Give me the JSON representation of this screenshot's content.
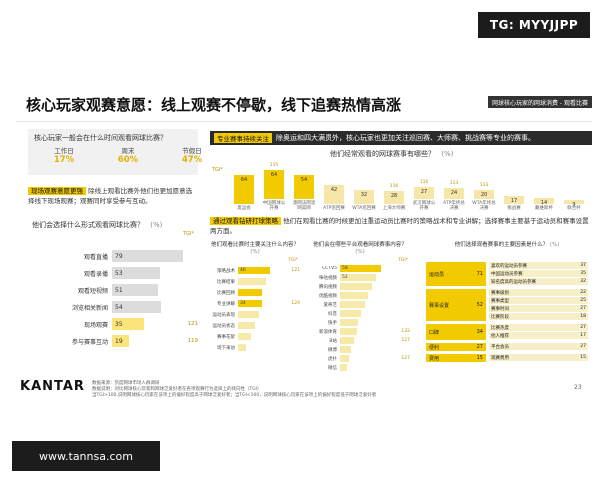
{
  "watermark_top": "TG: MYYJJPP",
  "watermark_bottom": "www.tannsa.com",
  "title": "核心玩家观赛意愿：线上观赛不停歇，线下追赛热情高涨",
  "section_tag": "网球核心玩家的网球消费 - 观看比赛",
  "q1": {
    "question": "核心玩家一般会在什么时间观看网球比赛？",
    "items": [
      {
        "label": "工作日",
        "value": "17%"
      },
      {
        "label": "周末",
        "value": "60%"
      },
      {
        "label": "节假日",
        "value": "47%"
      }
    ]
  },
  "insight_left": {
    "tag": "现场观赛意愿更强",
    "text": "除线上观看比赛外他们也更加愿意选择线下现场观赛；观赛同时享受参与互动。"
  },
  "q2": {
    "question": "他们会选择什么形式观看网球比赛？",
    "unit": "(%)",
    "tgi_label": "TGI*",
    "rows": [
      {
        "label": "观看直播",
        "value": "79",
        "pct": 79,
        "tgi": "",
        "hl": false
      },
      {
        "label": "观看录播",
        "value": "53",
        "pct": 53,
        "tgi": "",
        "hl": false
      },
      {
        "label": "观看短视频",
        "value": "51",
        "pct": 51,
        "tgi": "",
        "hl": false
      },
      {
        "label": "浏览相关新闻",
        "value": "54",
        "pct": 54,
        "tgi": "",
        "hl": false
      },
      {
        "label": "现场观赛",
        "value": "35",
        "pct": 35,
        "tgi": "121",
        "hl": true
      },
      {
        "label": "参与赛事互动",
        "value": "19",
        "pct": 19,
        "tgi": "119",
        "hl": true
      }
    ]
  },
  "insight_right1": {
    "tag": "专业赛事持续关注",
    "text": "除奥运和四大满贯外，核心玩家也更加关注巡回赛、大师赛、挑战赛等专业的赛事。"
  },
  "q3": {
    "question": "他们经常观看的网球赛事有哪些？",
    "unit": "(%)",
    "tgi_label": "TGI*",
    "cols": [
      {
        "label": "奥运会",
        "value": "64",
        "pct": 64,
        "tgi": "",
        "hl": true
      },
      {
        "label": "中国网球公开赛",
        "value": "64",
        "pct": 64,
        "tgi": "115",
        "hl": true
      },
      {
        "label": "澳网法网温网美网",
        "value": "54",
        "pct": 54,
        "tgi": "",
        "hl": true
      },
      {
        "label": "ATP巡回赛",
        "value": "42",
        "pct": 42,
        "tgi": "",
        "hl": false
      },
      {
        "label": "WTA巡回赛",
        "value": "32",
        "pct": 32,
        "tgi": "",
        "hl": false
      },
      {
        "label": "上海大师赛",
        "value": "28",
        "pct": 28,
        "tgi": "116",
        "hl": false
      },
      {
        "label": "武汉网球公开赛",
        "value": "27",
        "pct": 27,
        "tgi": "116",
        "hl": false
      },
      {
        "label": "ATP年终总决赛",
        "value": "24",
        "pct": 24,
        "tgi": "113",
        "hl": false
      },
      {
        "label": "WTA年终总决赛",
        "value": "20",
        "pct": 20,
        "tgi": "113",
        "hl": false
      },
      {
        "label": "挑战赛",
        "value": "17",
        "pct": 17,
        "tgi": "",
        "hl": false
      },
      {
        "label": "戴维斯杯",
        "value": "14",
        "pct": 14,
        "tgi": "",
        "hl": false
      },
      {
        "label": "联合杯",
        "value": "9",
        "pct": 9,
        "tgi": "",
        "hl": false
      }
    ]
  },
  "insight_right2": {
    "tag": "通过观看钻研打球策略",
    "text": "他们在观看比赛的时候更加注重运动员比赛时的策略战术和专业讲解；选择赛事主要基于运动员和赛事设置两方面。"
  },
  "mini1": {
    "title": "他们观看比赛时主要关注什么内容？",
    "unit": "(%)",
    "tgi_label": "TGI*",
    "rows": [
      {
        "label": "策略战术",
        "value": "46",
        "pct": 46,
        "tgi": "121",
        "hl": true
      },
      {
        "label": "比赛结果",
        "value": "",
        "pct": 40,
        "tgi": "",
        "hl": false
      },
      {
        "label": "比赛回顾",
        "value": "",
        "pct": 34,
        "tgi": "",
        "hl": true
      },
      {
        "label": "专业讲解",
        "value": "34",
        "pct": 34,
        "tgi": "124",
        "hl": true
      },
      {
        "label": "运动员表现",
        "value": "",
        "pct": 30,
        "tgi": "",
        "hl": false
      },
      {
        "label": "运动员状态",
        "value": "",
        "pct": 24,
        "tgi": "",
        "hl": false
      },
      {
        "label": "赛事花絮",
        "value": "",
        "pct": 18,
        "tgi": "",
        "hl": false
      },
      {
        "label": "场下采访",
        "value": "",
        "pct": 12,
        "tgi": "",
        "hl": false
      }
    ]
  },
  "mini2": {
    "title": "他们会在哪些平台观看网球赛事内容？",
    "unit": "(%)",
    "tgi_label": "TGI*",
    "rows": [
      {
        "label": "CCTV5",
        "value": "58",
        "pct": 58,
        "tgi": "",
        "hl": true
      },
      {
        "label": "咪咕视频",
        "value": "52",
        "pct": 52,
        "tgi": "",
        "hl": false
      },
      {
        "label": "腾讯视频",
        "value": "",
        "pct": 46,
        "tgi": "",
        "hl": false
      },
      {
        "label": "优酷视频",
        "value": "",
        "pct": 40,
        "tgi": "",
        "hl": false
      },
      {
        "label": "爱奇艺",
        "value": "",
        "pct": 35,
        "tgi": "",
        "hl": false
      },
      {
        "label": "抖音",
        "value": "",
        "pct": 30,
        "tgi": "",
        "hl": false
      },
      {
        "label": "快手",
        "value": "",
        "pct": 26,
        "tgi": "",
        "hl": false
      },
      {
        "label": "新浪体育",
        "value": "",
        "pct": 24,
        "tgi": "132",
        "hl": false
      },
      {
        "label": "B站",
        "value": "",
        "pct": 20,
        "tgi": "127",
        "hl": false
      },
      {
        "label": "微博",
        "value": "",
        "pct": 16,
        "tgi": "",
        "hl": false
      },
      {
        "label": "虎扑",
        "value": "",
        "pct": 13,
        "tgi": "127",
        "hl": false
      },
      {
        "label": "微信",
        "value": "",
        "pct": 10,
        "tgi": "",
        "hl": false
      }
    ]
  },
  "mini3": {
    "title": "他们选择观看赛事的主要因素是什么？",
    "unit": "(%)",
    "groups": [
      {
        "name": "运动员",
        "value": "71",
        "items": [
          {
            "label": "喜欢的运动员参赛",
            "value": "37"
          },
          {
            "label": "中国运动员参赛",
            "value": "35"
          },
          {
            "label": "知名度高的运动员参赛",
            "value": "32"
          }
        ]
      },
      {
        "name": "赛事设置",
        "value": "52",
        "items": [
          {
            "label": "赛事级别",
            "value": "22"
          },
          {
            "label": "赛事类型",
            "value": "25"
          },
          {
            "label": "赛事时间",
            "value": "27"
          },
          {
            "label": "比赛阶段",
            "value": "18"
          }
        ]
      },
      {
        "name": "口碑",
        "value": "34",
        "items": [
          {
            "label": "比赛热度",
            "value": "27"
          },
          {
            "label": "他人推荐",
            "value": "17"
          }
        ]
      },
      {
        "name": "便利",
        "value": "27",
        "items": [
          {
            "label": "平台会员",
            "value": "27"
          }
        ]
      },
      {
        "name": "费用",
        "value": "15",
        "items": [
          {
            "label": "观赛费用",
            "value": "15"
          }
        ]
      }
    ]
  },
  "footer": {
    "brand": "KANTAR",
    "source_line1": "数据来源：凯度网球市场人群调研",
    "source_line2": "数据说明：对比网球核心玩家和网球泛爱好者在各项观赛行为选择上的倾向性（TGI）",
    "source_line3": "当TGI>100,说明网球核心玩家在该项上的偏好程度高于网球泛爱好者；当TGI<100，说明网球核心玩家在该项上的偏好程度低于网球泛爱好者",
    "page": "23"
  }
}
